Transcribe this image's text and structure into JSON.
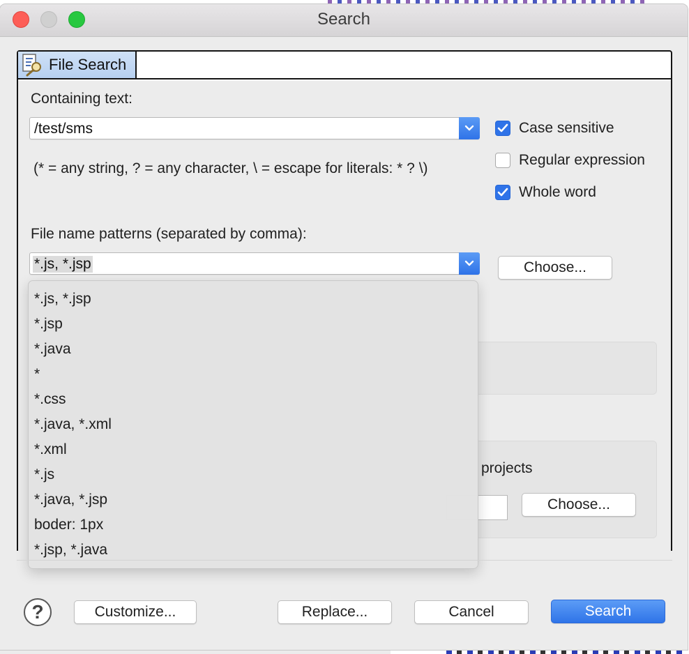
{
  "window": {
    "title": "Search"
  },
  "tab": {
    "label": "File Search"
  },
  "containing_text": {
    "label": "Containing text:",
    "value": "/test/sms",
    "hint": "(* = any string, ? = any character, \\ = escape for literals: * ? \\)"
  },
  "options": {
    "case_sensitive": {
      "label": "Case sensitive",
      "checked": true
    },
    "regular_expression": {
      "label": "Regular expression",
      "checked": false
    },
    "whole_word": {
      "label": "Whole word",
      "checked": true
    }
  },
  "file_patterns": {
    "label": "File name patterns (separated by comma):",
    "value": "*.js, *.jsp",
    "choose_label": "Choose...",
    "dropdown_items": [
      "*.js, *.jsp",
      "*.jsp",
      "*.java",
      "*",
      "*.css",
      "*.java, *.xml",
      "*.xml",
      "*.js",
      "*.java, *.jsp",
      "boder: 1px",
      "*.jsp, *.java"
    ]
  },
  "scope": {
    "projects_label": "projects",
    "choose_label": "Choose..."
  },
  "buttons": {
    "help": "?",
    "customize": "Customize...",
    "replace": "Replace...",
    "cancel": "Cancel",
    "search": "Search"
  },
  "colors": {
    "accent": "#2f73e8",
    "close": "#fd5e57",
    "maximize": "#28c840"
  }
}
